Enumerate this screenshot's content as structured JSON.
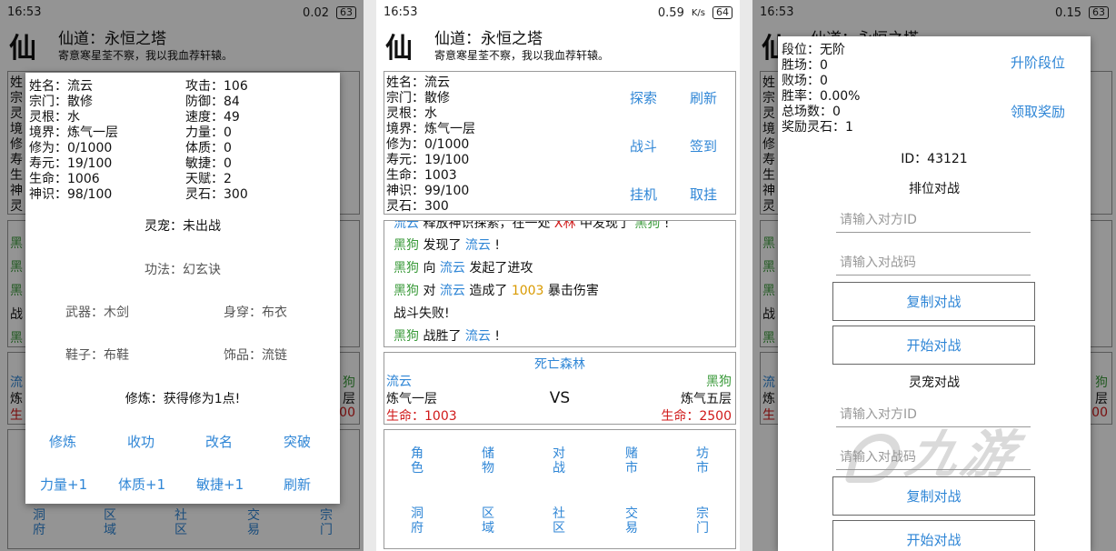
{
  "status": {
    "time1": "16:53",
    "net1": "0.02",
    "batt1": "63",
    "time2": "16:53",
    "net2": "0.59",
    "batt2": "64",
    "time3": "16:53",
    "net3": "0.15",
    "batt3": "63",
    "unit": "K/s"
  },
  "header": {
    "logo": "仙",
    "title": "仙道：永恒之塔",
    "subtitle": "寄意寒星荃不察，我以我血荐轩辕。"
  },
  "stats": {
    "name": "姓名：流云",
    "sect": "宗门：散修",
    "root": "灵根：水",
    "realm": "境界：炼气一层",
    "cultivation": "修为：0/1000",
    "lifespan": "寿元：19/100",
    "hp": "生命：1003",
    "spirit": "神识：99/100",
    "stones": "灵石：300"
  },
  "actions": {
    "explore": "探索",
    "refresh": "刷新",
    "fight": "战斗",
    "checkin": "签到",
    "idle": "挂机",
    "cancel_idle": "取挂"
  },
  "log": [
    {
      "parts": [
        [
          "黑狗",
          "g"
        ],
        [
          " 发现了 ",
          ""
        ],
        [
          "流云",
          "b"
        ],
        [
          " !",
          ""
        ]
      ]
    },
    {
      "parts": [
        [
          "黑狗",
          "g"
        ],
        [
          " 向 ",
          ""
        ],
        [
          "流云",
          "b"
        ],
        [
          " 发起了进攻",
          ""
        ]
      ]
    },
    {
      "parts": [
        [
          "黑狗",
          "g"
        ],
        [
          " 对 ",
          ""
        ],
        [
          "流云",
          "b"
        ],
        [
          " 造成了 ",
          ""
        ],
        [
          "1003",
          "o"
        ],
        [
          " 暴击伤害",
          ""
        ]
      ]
    },
    {
      "parts": [
        [
          "战斗失败!",
          ""
        ]
      ]
    },
    {
      "parts": [
        [
          "黑狗",
          "g"
        ],
        [
          " 战胜了 ",
          ""
        ],
        [
          "流云",
          "b"
        ],
        [
          " !",
          ""
        ]
      ]
    }
  ],
  "log_partial": {
    "a": "流云",
    "b": " 释放神识探索，在一处 ",
    "c": "X林",
    "d": " 中发现了 ",
    "e": "黑狗",
    "f": " !"
  },
  "battle": {
    "location": "死亡森林",
    "player": "流云",
    "enemy": "黑狗",
    "player_realm": "炼气一层",
    "enemy_realm": "炼气五层",
    "vs": "VS",
    "player_hp": "生命：1003",
    "enemy_hp": "生命：2500"
  },
  "nav": {
    "row1": [
      "角色",
      "储物",
      "对战",
      "赌市",
      "坊市"
    ],
    "row2": [
      "洞府",
      "区域",
      "社区",
      "交易",
      "宗门"
    ]
  },
  "char_dialog": {
    "name": "姓名：流云",
    "attack": "攻击：106",
    "sect": "宗门：散修",
    "defense": "防御：84",
    "root": "灵根：水",
    "speed": "速度：49",
    "realm": "境界：炼气一层",
    "strength": "力量：0",
    "cultivation": "修为：0/1000",
    "constitution": "体质：0",
    "lifespan": "寿元：19/100",
    "agility": "敏捷：0",
    "hp": "生命：1006",
    "talent": "天赋：2",
    "spirit": "神识：98/100",
    "stones": "灵石：300",
    "pet": "灵宠：未出战",
    "technique": "功法：幻玄诀",
    "weapon": "武器：木剑",
    "armor": "身穿：布衣",
    "shoes": "鞋子：布鞋",
    "accessory": "饰品：流链",
    "practice_msg": "修炼：获得修为1点!",
    "btn_practice": "修炼",
    "btn_stop": "收功",
    "btn_rename": "改名",
    "btn_breakthrough": "突破",
    "btn_str": "力量+1",
    "btn_con": "体质+1",
    "btn_agi": "敏捷+1",
    "btn_refresh": "刷新"
  },
  "bg1": {
    "side": [
      "姓",
      "宗",
      "灵",
      "境",
      "修",
      "寿",
      "生",
      "神",
      "灵"
    ],
    "green": [
      "黑",
      "黑",
      "黑"
    ],
    "fight": "战",
    "stripe": "黑",
    "liu": "流",
    "lian": "炼",
    "sheng": "生",
    "gou": "狗",
    "ceng": "层",
    "hp_tail": "00",
    "nav": [
      "洞\n府",
      "区\n域",
      "社\n区",
      "交\n易",
      "宗\n门"
    ]
  },
  "bg3": {
    "side": [
      "姓",
      "宗",
      "灵",
      "境",
      "修",
      "寿",
      "生",
      "神",
      "灵"
    ],
    "green": [
      "黑",
      "黑",
      "黑"
    ],
    "fight": "战",
    "stripe": "黑",
    "liu": "流",
    "lian": "炼",
    "sheng": "生",
    "gou": "狗",
    "ceng": "层",
    "hp_tail": "00"
  },
  "pvp_dialog": {
    "rank": "段位：无阶",
    "wins": "胜场：0",
    "losses": "败场：0",
    "winrate": "胜率：0.00%",
    "total": "总场数：0",
    "reward_stones": "奖励灵石：1",
    "btn_upgrade": "升阶段位",
    "btn_reward": "领取奖励",
    "id": "ID：43121",
    "ranked_title": "排位对战",
    "ph_id": "请输入对方ID",
    "ph_code": "请输入对战码",
    "btn_copy": "复制对战",
    "btn_start": "开始对战",
    "pet_title": "灵宠对战",
    "ph_id2": "请输入对方ID",
    "ph_code2": "请输入对战码",
    "btn_copy2": "复制对战",
    "btn_start2": "开始对战"
  },
  "watermark": "九游"
}
